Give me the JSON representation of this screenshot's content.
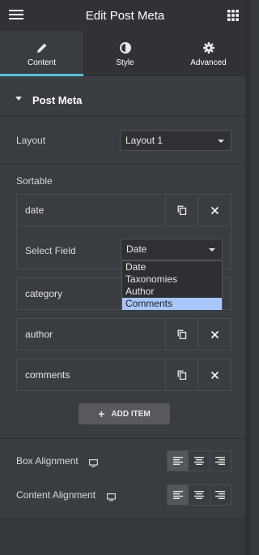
{
  "header": {
    "title": "Edit Post Meta",
    "menu_icon": "hamburger-icon",
    "apps_icon": "grid-icon"
  },
  "tabs": [
    {
      "label": "Content",
      "icon": "pencil-icon",
      "active": true
    },
    {
      "label": "Style",
      "icon": "half-circle-icon",
      "active": false
    },
    {
      "label": "Advanced",
      "icon": "gear-icon",
      "active": false
    }
  ],
  "section": {
    "title": "Post Meta"
  },
  "layout": {
    "label": "Layout",
    "value": "Layout 1"
  },
  "sortable": {
    "label": "Sortable",
    "items": [
      {
        "label": "date",
        "expanded": true
      },
      {
        "label": "category"
      },
      {
        "label": "author"
      },
      {
        "label": "comments"
      }
    ],
    "select_field": {
      "label": "Select Field",
      "value": "Date",
      "options": [
        "Date",
        "Taxonomies",
        "Author",
        "Comments"
      ],
      "highlighted": "Comments"
    }
  },
  "add_item": {
    "label": "ADD ITEM"
  },
  "box_alignment": {
    "label": "Box Alignment",
    "selected": "left"
  },
  "content_alignment": {
    "label": "Content Alignment",
    "selected": "left"
  },
  "colors": {
    "accent": "#5bc0de",
    "highlight": "#a8c7fa"
  }
}
